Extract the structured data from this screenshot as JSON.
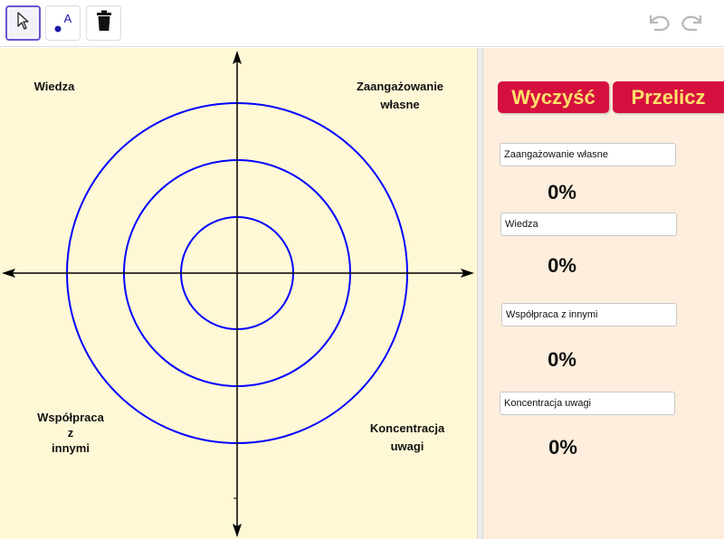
{
  "toolbar": {
    "tools": [
      {
        "icon": "cursor-arrow-icon",
        "active": true
      },
      {
        "icon": "point-icon",
        "glyph": "A"
      },
      {
        "icon": "trash-icon"
      }
    ],
    "undo_icon": "undo-icon",
    "redo_icon": "redo-icon"
  },
  "graphics": {
    "labels": {
      "top_left": "Wiedza",
      "top_right": [
        "Zaangażowanie",
        "własne"
      ],
      "bottom_left": [
        "Współpraca",
        "z",
        "innymi"
      ],
      "bottom_right": [
        "Koncentracja",
        "uwagi"
      ]
    },
    "circle_color": "#0000ff",
    "background_color": "#fff8d6"
  },
  "panel": {
    "clear_button": "Wyczyść",
    "recalc_button": "Przelicz",
    "fields": [
      {
        "value": "Zaangażowanie własne",
        "percent": "0%"
      },
      {
        "value": "Wiedza",
        "percent": "0%"
      },
      {
        "value": "Współpraca z innymi",
        "percent": "0%"
      },
      {
        "value": "Koncentracja uwagi",
        "percent": "0%"
      }
    ],
    "button_color": "#d6103e",
    "button_text_color": "#ffe06b",
    "background_color": "#fdeedd"
  }
}
